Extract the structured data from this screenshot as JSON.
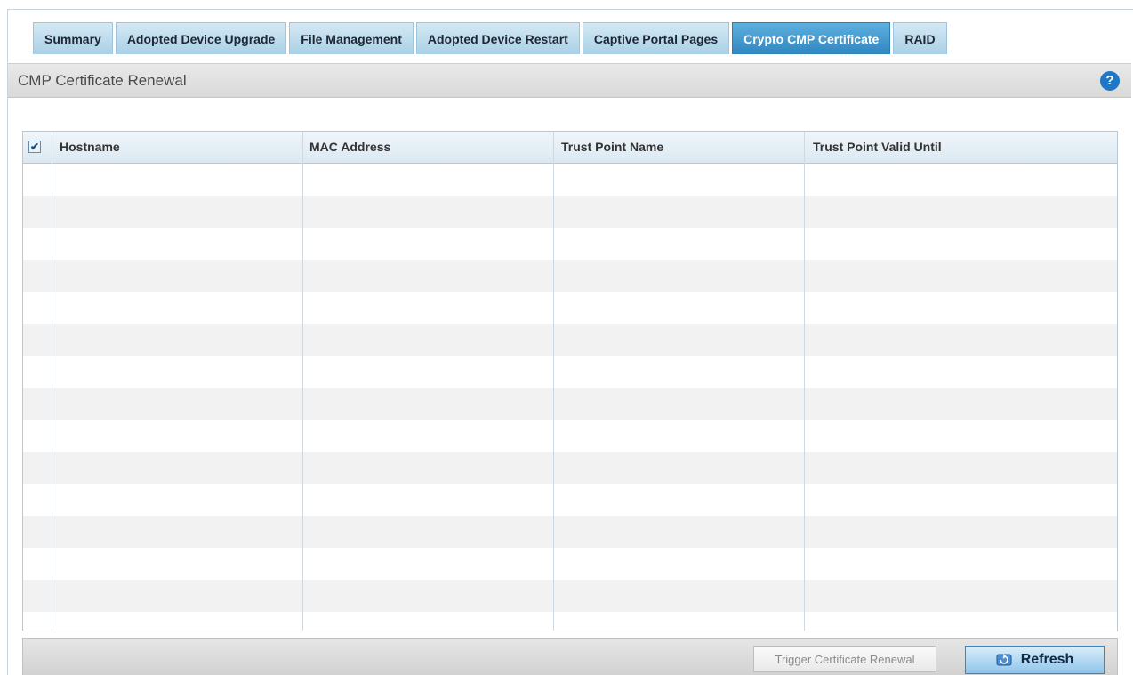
{
  "tabs": [
    {
      "label": "Summary"
    },
    {
      "label": "Adopted Device Upgrade"
    },
    {
      "label": "File Management"
    },
    {
      "label": "Adopted Device Restart"
    },
    {
      "label": "Captive Portal Pages"
    },
    {
      "label": "Crypto CMP Certificate"
    },
    {
      "label": "RAID"
    }
  ],
  "section": {
    "title": "CMP Certificate Renewal",
    "help_icon": "question-circle-icon"
  },
  "table": {
    "select_all_checked": true,
    "columns": [
      "Hostname",
      "MAC Address",
      "Trust Point Name",
      "Trust Point Valid Until"
    ],
    "rows": []
  },
  "buttons": {
    "trigger_label": "Trigger Certificate Renewal",
    "refresh_label": "Refresh",
    "refresh_icon": "refresh-icon"
  },
  "colors": {
    "active_tab": "#2f86bf",
    "help_icon": "#1e77c7"
  }
}
